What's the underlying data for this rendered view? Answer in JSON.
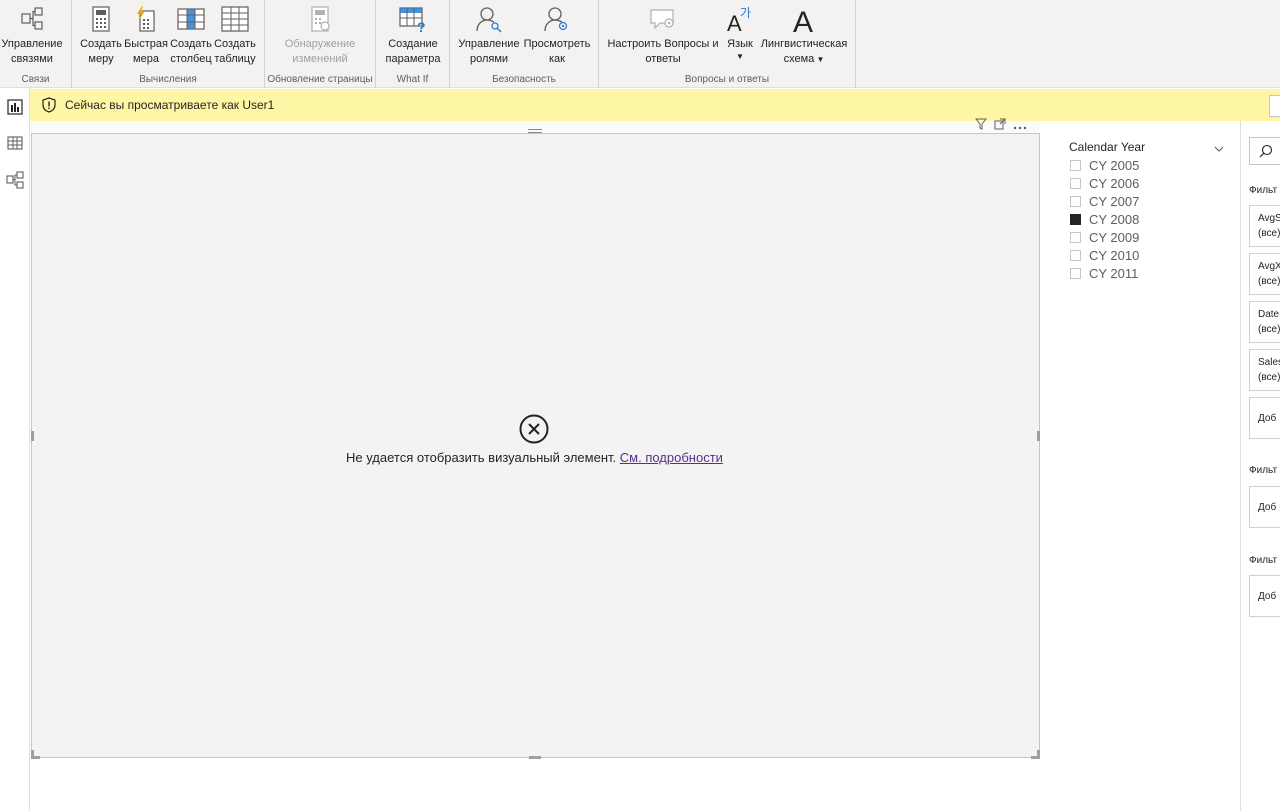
{
  "ribbon": {
    "groups": {
      "links": "Связи",
      "calculations": "Вычисления",
      "page_refresh": "Обновление страницы",
      "whatif": "What If",
      "security": "Безопасность",
      "qa": "Вопросы и ответы"
    },
    "buttons": {
      "manage_relationships": [
        "Управление",
        "связями"
      ],
      "new_measure": [
        "Создать",
        "меру"
      ],
      "quick_measure": [
        "Быстрая",
        "мера"
      ],
      "new_column": [
        "Создать",
        "столбец"
      ],
      "new_table": [
        "Создать",
        "таблицу"
      ],
      "change_detection": [
        "Обнаружение",
        "изменений"
      ],
      "new_parameter": [
        "Создание",
        "параметра"
      ],
      "manage_roles": [
        "Управление",
        "ролями"
      ],
      "view_as": [
        "Просмотреть",
        "как"
      ],
      "qa_setup": [
        "Настроить Вопросы и",
        "ответы"
      ],
      "language": "Язык",
      "linguistic_schema": [
        "Лингвистическая",
        "схема"
      ]
    }
  },
  "banner": {
    "text": "Сейчас вы просматриваете как User1"
  },
  "visual": {
    "error_text": "Не удается отобразить визуальный элемент.",
    "error_link": "См. подробности"
  },
  "slicer": {
    "title": "Calendar Year",
    "items": [
      {
        "label": "CY 2005",
        "checked": false
      },
      {
        "label": "CY 2006",
        "checked": false
      },
      {
        "label": "CY 2007",
        "checked": false
      },
      {
        "label": "CY 2008",
        "checked": true
      },
      {
        "label": "CY 2009",
        "checked": false
      },
      {
        "label": "CY 2010",
        "checked": false
      },
      {
        "label": "CY 2011",
        "checked": false
      }
    ]
  },
  "filters": {
    "heading1": "Фильт",
    "heading2": "Фильт",
    "heading3": "Фильт",
    "cards": [
      {
        "name": "AvgS",
        "value": "(все)"
      },
      {
        "name": "AvgX",
        "value": "(все)"
      },
      {
        "name": "Date",
        "value": "(все)"
      },
      {
        "name": "Sales",
        "value": "(все)"
      }
    ],
    "add_label": "Доб"
  },
  "colors": {
    "ribbon_bg": "#f3f2f1",
    "banner_bg": "#fdf6a5",
    "accent_blue": "#2b7cd3",
    "link_purple": "#5c2d91"
  }
}
